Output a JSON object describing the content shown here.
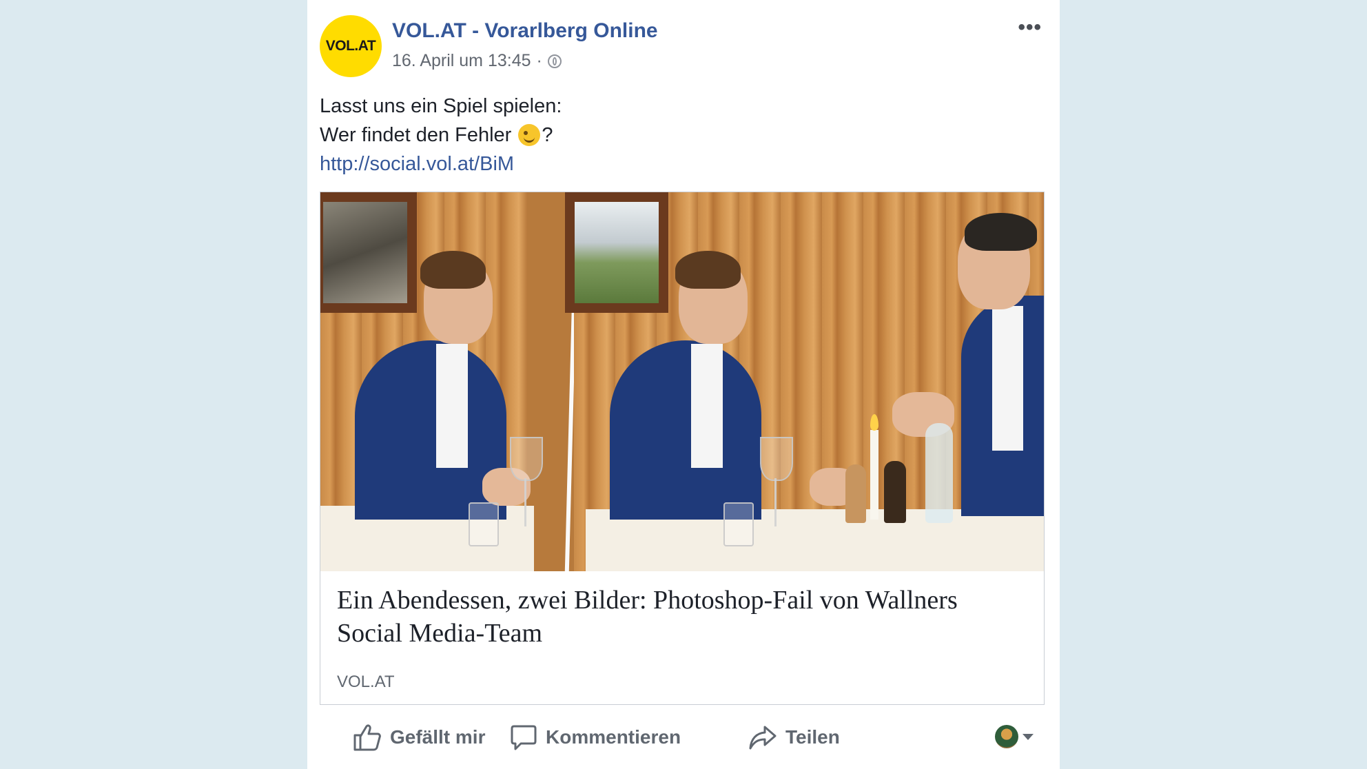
{
  "post": {
    "page_name": "VOL.AT - Vorarlberg Online",
    "avatar_text": "VOL.AT",
    "timestamp": "16. April um 13:45",
    "separator": "·",
    "audience_icon": "globe-icon",
    "text_line1": "Lasst uns ein Spiel spielen:",
    "text_line2": "Wer findet den Fehler",
    "text_line2_suffix": "?",
    "emoji": "winking-face-icon",
    "link": "http://social.vol.at/BiM",
    "more_label": "•••"
  },
  "link_preview": {
    "title": "Ein Abendessen, zwei Bilder: Photoshop-Fail von Wallners Social Media-Team",
    "domain": "VOL.AT"
  },
  "actions": {
    "like": "Gefällt mir",
    "comment": "Kommentieren",
    "share": "Teilen"
  },
  "colors": {
    "background": "#dceaf0",
    "link_blue": "#365899",
    "avatar_yellow": "#ffdc00"
  }
}
